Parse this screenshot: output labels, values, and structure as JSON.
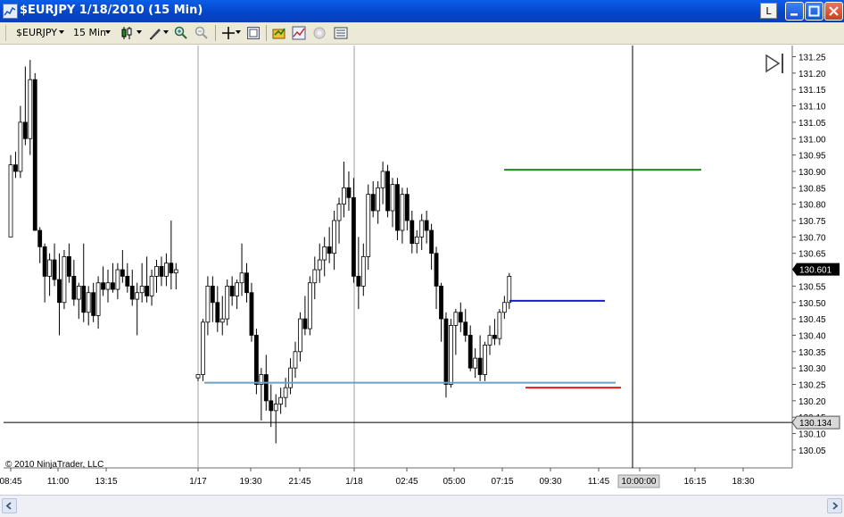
{
  "window": {
    "title": "$EURJPY  1/18/2010 (15 Min)",
    "l_button": "L"
  },
  "toolbar": {
    "instrument": "$EURJPY",
    "period": "15 Min"
  },
  "copyright": "© 2010 NinjaTrader, LLC",
  "price_axis": {
    "ticks": [
      "131.25",
      "131.20",
      "131.15",
      "131.10",
      "131.05",
      "131.00",
      "130.95",
      "130.90",
      "130.85",
      "130.80",
      "130.75",
      "130.70",
      "130.65",
      "130.60",
      "130.55",
      "130.50",
      "130.45",
      "130.40",
      "130.35",
      "130.30",
      "130.25",
      "130.20",
      "130.15",
      "130.10",
      "130.05"
    ],
    "last_price_label": "130.601",
    "last_price_color": "#000000",
    "crosshair_price_label": "130.134"
  },
  "time_axis": {
    "labels": [
      "08:45",
      "11:00",
      "13:15",
      "1/17",
      "19:30",
      "21:45",
      "1/18",
      "02:45",
      "05:00",
      "07:15",
      "09:30",
      "11:45",
      "10:00:00",
      "16:15",
      "18:30"
    ],
    "crosshair_time_label": "10:00:00"
  },
  "chart_data": {
    "type": "candlestick",
    "ylim": [
      130.04,
      131.27
    ],
    "up_color": "#ffffff",
    "down_color": "#000000",
    "candles": [
      [
        130.7,
        130.95,
        130.7,
        130.92
      ],
      [
        130.92,
        130.96,
        130.88,
        130.9
      ],
      [
        130.9,
        131.1,
        130.88,
        131.05
      ],
      [
        131.05,
        131.22,
        130.98,
        131.0
      ],
      [
        131.0,
        131.24,
        130.95,
        131.18
      ],
      [
        131.18,
        131.2,
        130.72,
        130.72
      ],
      [
        130.72,
        130.73,
        130.62,
        130.67
      ],
      [
        130.67,
        130.68,
        130.5,
        130.58
      ],
      [
        130.58,
        130.65,
        130.52,
        130.63
      ],
      [
        130.63,
        130.68,
        130.55,
        130.57
      ],
      [
        130.57,
        130.65,
        130.4,
        130.5
      ],
      [
        130.5,
        130.66,
        130.48,
        130.64
      ],
      [
        130.64,
        130.68,
        130.56,
        130.58
      ],
      [
        130.58,
        130.63,
        130.49,
        130.51
      ],
      [
        130.51,
        130.56,
        130.45,
        130.55
      ],
      [
        130.55,
        130.68,
        130.44,
        130.47
      ],
      [
        130.47,
        130.55,
        130.43,
        130.53
      ],
      [
        130.53,
        130.56,
        130.44,
        130.46
      ],
      [
        130.46,
        130.58,
        130.42,
        130.56
      ],
      [
        130.56,
        130.61,
        130.52,
        130.54
      ],
      [
        130.54,
        130.6,
        130.5,
        130.56
      ],
      [
        130.56,
        130.62,
        130.53,
        130.54
      ],
      [
        130.54,
        130.62,
        130.51,
        130.6
      ],
      [
        130.6,
        130.66,
        130.56,
        130.58
      ],
      [
        130.58,
        130.62,
        130.53,
        130.55
      ],
      [
        130.55,
        130.6,
        130.49,
        130.51
      ],
      [
        130.51,
        130.56,
        130.4,
        130.53
      ],
      [
        130.53,
        130.62,
        130.5,
        130.55
      ],
      [
        130.55,
        130.64,
        130.5,
        130.52
      ],
      [
        130.52,
        130.6,
        130.49,
        130.58
      ],
      [
        130.58,
        130.63,
        130.53,
        130.61
      ],
      [
        130.61,
        130.64,
        130.55,
        130.58
      ],
      [
        130.58,
        130.65,
        130.55,
        130.62
      ],
      [
        130.62,
        130.75,
        130.54,
        130.59
      ],
      [
        130.59,
        130.62,
        130.54,
        130.6
      ],
      [
        130.27,
        130.28,
        130.26,
        130.28
      ],
      [
        130.28,
        130.45,
        130.26,
        130.44
      ],
      [
        130.44,
        130.58,
        130.4,
        130.55
      ],
      [
        130.55,
        130.58,
        130.44,
        130.5
      ],
      [
        130.5,
        130.55,
        130.41,
        130.44
      ],
      [
        130.44,
        130.52,
        130.4,
        130.45
      ],
      [
        130.45,
        130.57,
        130.43,
        130.55
      ],
      [
        130.55,
        130.58,
        130.49,
        130.52
      ],
      [
        130.52,
        130.57,
        130.48,
        130.56
      ],
      [
        130.56,
        130.68,
        130.52,
        130.59
      ],
      [
        130.59,
        130.62,
        130.5,
        130.53
      ],
      [
        130.53,
        130.56,
        130.38,
        130.4
      ],
      [
        130.4,
        130.42,
        130.22,
        130.25
      ],
      [
        130.25,
        130.3,
        130.14,
        130.28
      ],
      [
        130.28,
        130.34,
        130.17,
        130.2
      ],
      [
        130.2,
        130.25,
        130.12,
        130.17
      ],
      [
        130.17,
        130.22,
        130.07,
        130.19
      ],
      [
        130.19,
        130.24,
        130.16,
        130.21
      ],
      [
        130.21,
        130.27,
        130.18,
        130.24
      ],
      [
        130.24,
        130.33,
        130.22,
        130.3
      ],
      [
        130.3,
        130.38,
        130.27,
        130.35
      ],
      [
        130.35,
        130.47,
        130.32,
        130.45
      ],
      [
        130.45,
        130.52,
        130.4,
        130.42
      ],
      [
        130.42,
        130.58,
        130.4,
        130.56
      ],
      [
        130.56,
        130.64,
        130.51,
        130.6
      ],
      [
        130.6,
        130.68,
        130.56,
        130.63
      ],
      [
        130.63,
        130.7,
        130.58,
        130.67
      ],
      [
        130.67,
        130.73,
        130.62,
        130.65
      ],
      [
        130.65,
        130.78,
        130.6,
        130.75
      ],
      [
        130.75,
        130.82,
        130.68,
        130.8
      ],
      [
        130.8,
        130.93,
        130.76,
        130.85
      ],
      [
        130.85,
        130.9,
        130.78,
        130.82
      ],
      [
        130.82,
        130.88,
        130.56,
        130.58
      ],
      [
        130.58,
        130.7,
        130.48,
        130.55
      ],
      [
        130.55,
        130.68,
        130.52,
        130.64
      ],
      [
        130.64,
        130.86,
        130.6,
        130.83
      ],
      [
        130.83,
        130.87,
        130.76,
        130.78
      ],
      [
        130.78,
        130.87,
        130.74,
        130.85
      ],
      [
        130.85,
        130.93,
        130.8,
        130.9
      ],
      [
        130.9,
        130.92,
        130.76,
        130.78
      ],
      [
        130.78,
        130.88,
        130.73,
        130.86
      ],
      [
        130.86,
        130.88,
        130.69,
        130.72
      ],
      [
        130.72,
        130.85,
        130.68,
        130.83
      ],
      [
        130.83,
        130.85,
        130.72,
        130.75
      ],
      [
        130.75,
        130.78,
        130.65,
        130.68
      ],
      [
        130.68,
        130.72,
        130.65,
        130.7
      ],
      [
        130.7,
        130.77,
        130.66,
        130.75
      ],
      [
        130.75,
        130.78,
        130.68,
        130.72
      ],
      [
        130.72,
        130.74,
        130.6,
        130.65
      ],
      [
        130.65,
        130.67,
        130.48,
        130.55
      ],
      [
        130.55,
        130.56,
        130.38,
        130.45
      ],
      [
        130.45,
        130.47,
        130.21,
        130.25
      ],
      [
        130.25,
        130.45,
        130.24,
        130.43
      ],
      [
        130.43,
        130.48,
        130.34,
        130.47
      ],
      [
        130.47,
        130.5,
        130.41,
        130.44
      ],
      [
        130.44,
        130.48,
        130.38,
        130.4
      ],
      [
        130.4,
        130.43,
        130.29,
        130.3
      ],
      [
        130.3,
        130.36,
        130.27,
        130.33
      ],
      [
        130.33,
        130.4,
        130.26,
        130.28
      ],
      [
        130.28,
        130.38,
        130.26,
        130.37
      ],
      [
        130.37,
        130.43,
        130.34,
        130.4
      ],
      [
        130.4,
        130.45,
        130.37,
        130.39
      ],
      [
        130.39,
        130.48,
        130.37,
        130.47
      ],
      [
        130.47,
        130.52,
        130.45,
        130.5
      ],
      [
        130.5,
        130.59,
        130.48,
        130.58
      ]
    ],
    "horizontal_lines": [
      {
        "price": 130.905,
        "color": "#1a8c1a"
      },
      {
        "price": 130.505,
        "color": "#1a1ad0"
      },
      {
        "price": 130.255,
        "color": "#6ba0c8"
      },
      {
        "price": 130.24,
        "color": "#e81a1a"
      }
    ],
    "crosshair": {
      "time": "10:00:00",
      "price": 130.134
    },
    "vertical_dividers": [
      "1/17",
      "1/18"
    ]
  }
}
